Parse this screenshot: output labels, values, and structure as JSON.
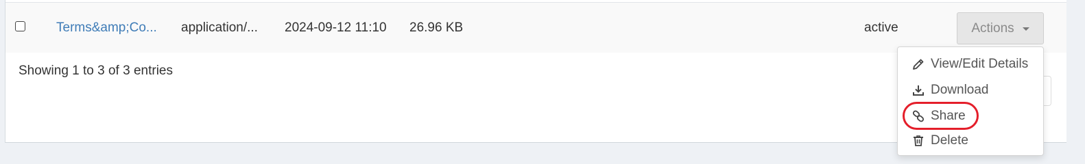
{
  "table": {
    "row": {
      "filename": "Terms&amp;Co...",
      "mime_type": "application/...",
      "date": "2024-09-12 11:10",
      "size": "26.96 KB",
      "status": "active"
    },
    "actions_label": "Actions"
  },
  "footer": {
    "entries_info": "Showing 1 to 3 of 3 entries"
  },
  "menu": {
    "items": [
      {
        "label": "View/Edit Details",
        "icon": "pencil-icon"
      },
      {
        "label": "Download",
        "icon": "download-icon"
      },
      {
        "label": "Share",
        "icon": "link-icon"
      },
      {
        "label": "Delete",
        "icon": "trash-icon"
      }
    ]
  },
  "colors": {
    "link": "#3f7cb7",
    "highlight": "#e41e2a"
  }
}
